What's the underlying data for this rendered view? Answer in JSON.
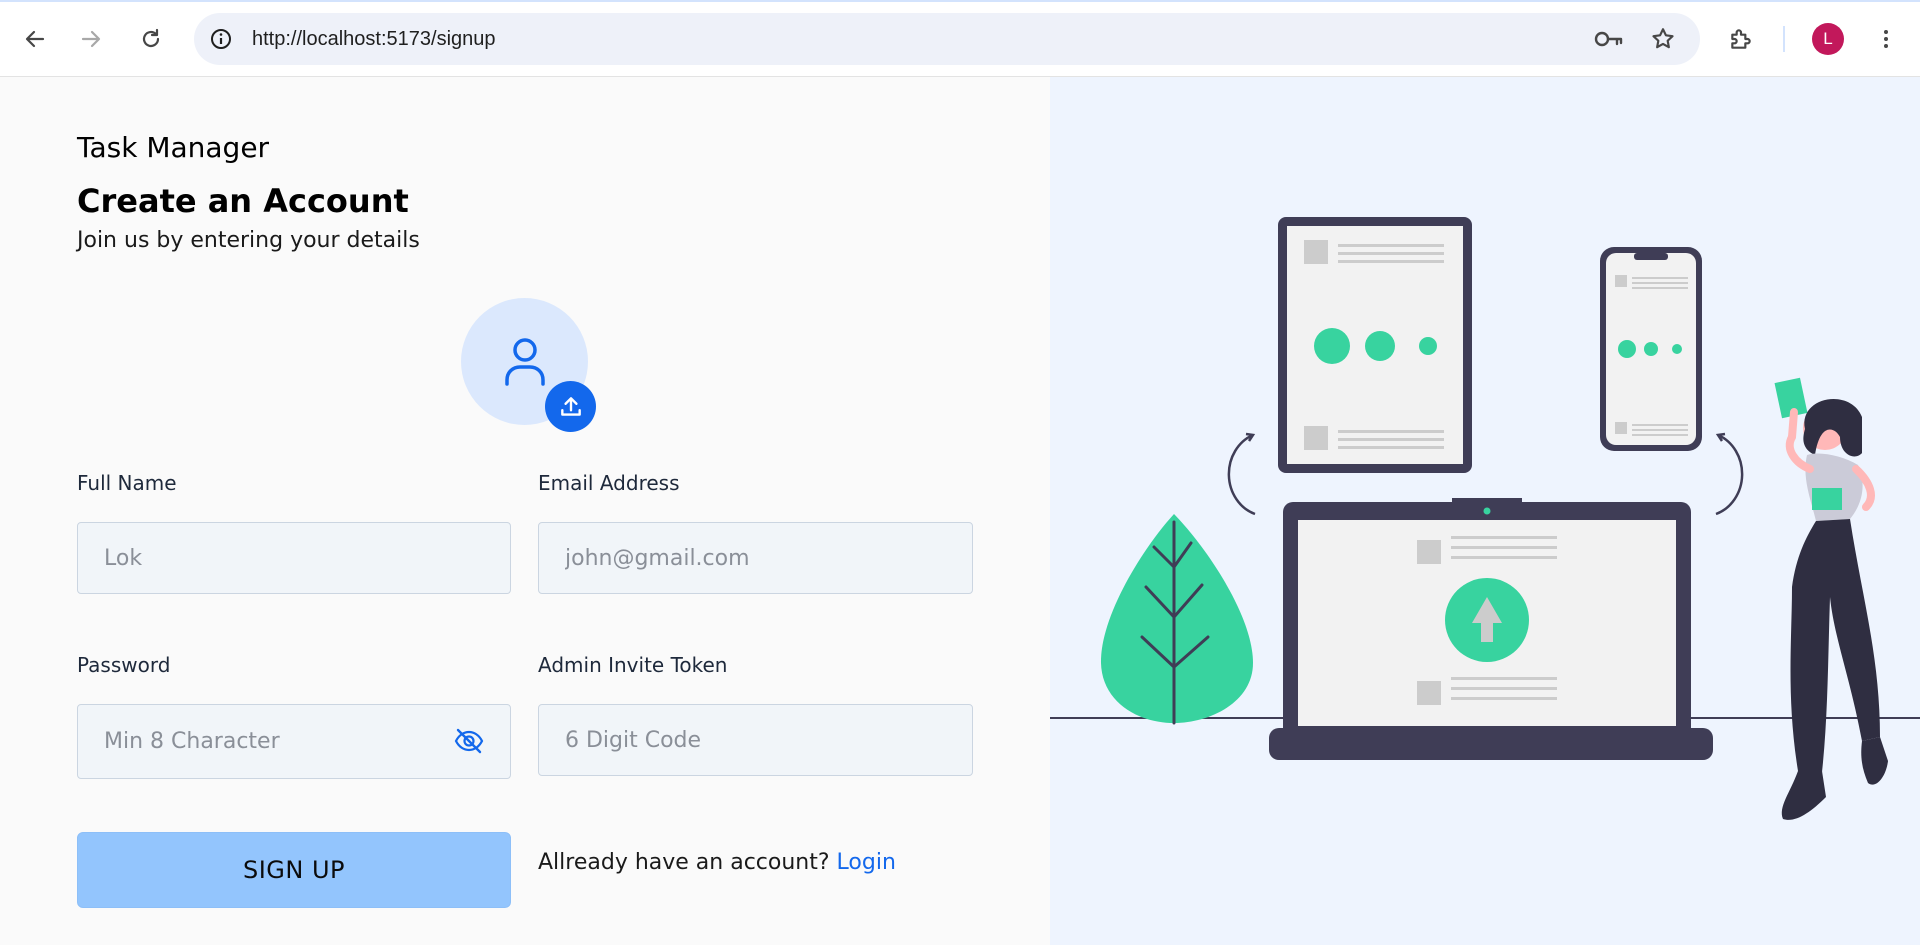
{
  "browser": {
    "url": "http://localhost:5173/signup",
    "profile_initial": "L",
    "icons": [
      "back-icon",
      "forward-icon",
      "reload-icon",
      "site-info-icon",
      "password-key-icon",
      "bookmark-star-icon",
      "extensions-icon",
      "menu-icon"
    ]
  },
  "app": {
    "brand": "Task Manager",
    "title": "Create an Account",
    "subtitle": "Join us by entering your details"
  },
  "form": {
    "full_name": {
      "label": "Full Name",
      "placeholder": "Lok"
    },
    "email": {
      "label": "Email Address",
      "placeholder": "john@gmail.com"
    },
    "password": {
      "label": "Password",
      "placeholder": "Min 8 Character"
    },
    "admin_token": {
      "label": "Admin Invite Token",
      "placeholder": "6 Digit Code"
    },
    "submit_label": "SIGN UP"
  },
  "footer": {
    "prompt": "Allready have an account?",
    "login_label": "Login"
  },
  "colors": {
    "accent": "#1368ec",
    "button": "#93c5fd",
    "illustration_green": "#38d39f",
    "illustration_dark": "#3f3d56"
  }
}
